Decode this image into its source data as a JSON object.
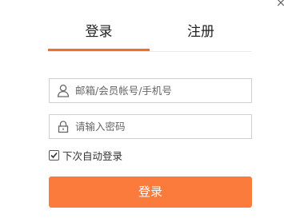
{
  "window": {
    "close_glyph": "×"
  },
  "tabs": [
    {
      "label": "登录",
      "active": true
    },
    {
      "label": "注册",
      "active": false
    }
  ],
  "accent_color": "#f36d2b",
  "form": {
    "account": {
      "placeholder": "邮箱/会员帐号/手机号",
      "value": "",
      "icon": "user-icon"
    },
    "password": {
      "placeholder": "请输入密码",
      "value": "",
      "icon": "lock-icon"
    },
    "remember": {
      "label": "下次自动登录",
      "checked": true
    },
    "submit_label": "登录",
    "submit_color": "#fb7b3c"
  }
}
